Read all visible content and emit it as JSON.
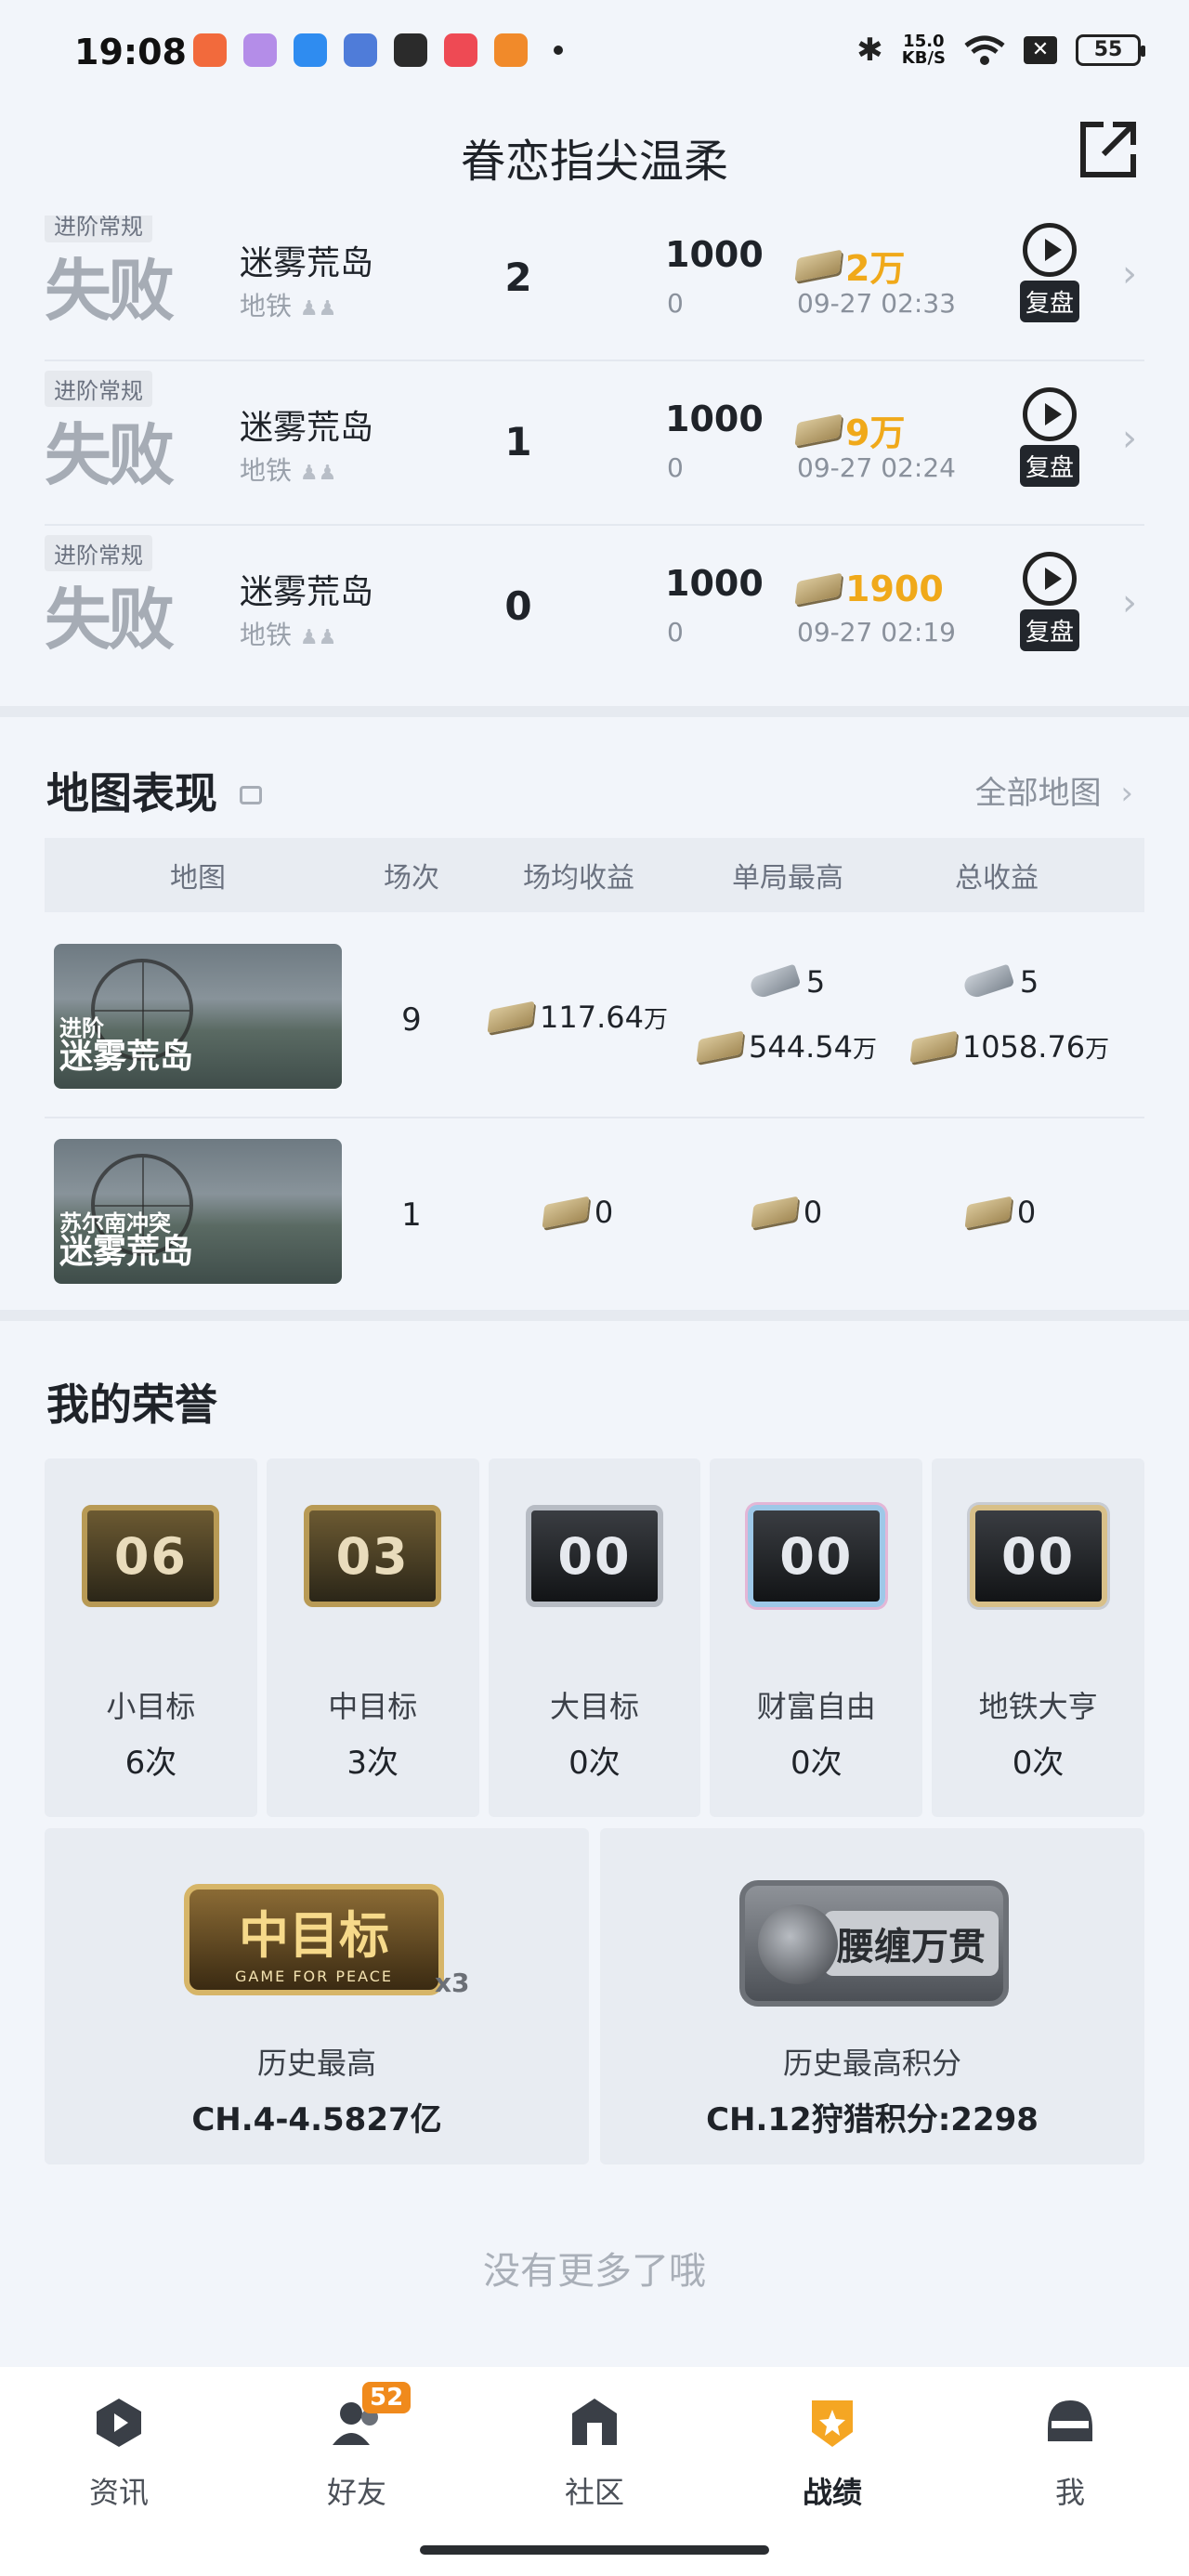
{
  "status_bar": {
    "time": "19:08",
    "net_speed": "15.0",
    "net_unit": "KB/S",
    "battery": "55"
  },
  "header": {
    "title": "眷恋指尖温柔"
  },
  "matches": [
    {
      "tag": "进阶常规",
      "result": "失败",
      "map": "迷雾荒岛",
      "mode": "地铁",
      "kills": "2",
      "score": "1000",
      "score_sub": "0",
      "reward": "2万",
      "time": "09-27 02:33",
      "replay": "复盘"
    },
    {
      "tag": "进阶常规",
      "result": "失败",
      "map": "迷雾荒岛",
      "mode": "地铁",
      "kills": "1",
      "score": "1000",
      "score_sub": "0",
      "reward": "9万",
      "time": "09-27 02:24",
      "replay": "复盘"
    },
    {
      "tag": "进阶常规",
      "result": "失败",
      "map": "迷雾荒岛",
      "mode": "地铁",
      "kills": "0",
      "score": "1000",
      "score_sub": "0",
      "reward": "1900",
      "time": "09-27 02:19",
      "replay": "复盘"
    }
  ],
  "map_section": {
    "title": "地图表现",
    "all_link": "全部地图",
    "columns": [
      "地图",
      "场次",
      "场均收益",
      "单局最高",
      "总收益"
    ],
    "rows": [
      {
        "sub": "进阶",
        "name": "迷雾荒岛",
        "count": "9",
        "avg": "117.64",
        "avg_unit": "万",
        "max_gun": "5",
        "max_cash": "544.54",
        "max_unit": "万",
        "total_gun": "5",
        "total_cash": "1058.76",
        "total_unit": "万"
      },
      {
        "sub": "苏尔南冲突",
        "name": "迷雾荒岛",
        "count": "1",
        "avg": "0",
        "max": "0",
        "total": "0"
      }
    ]
  },
  "honors": {
    "title": "我的荣誉",
    "items": [
      {
        "badge": "06",
        "name": "小目标",
        "count": "6次"
      },
      {
        "badge": "03",
        "name": "中目标",
        "count": "3次"
      },
      {
        "badge": "00",
        "name": "大目标",
        "count": "0次"
      },
      {
        "badge": "00",
        "name": "财富自由",
        "count": "0次"
      },
      {
        "badge": "00",
        "name": "地铁大亨",
        "count": "0次"
      }
    ],
    "history": [
      {
        "badge_main": "中目标",
        "badge_sub": "GAME FOR PEACE",
        "multiplier": "x3",
        "label": "历史最高",
        "value": "CH.4-4.5827亿"
      },
      {
        "badge_main": "腰缠万贯",
        "label": "历史最高积分",
        "value": "CH.12狩猎积分:2298"
      }
    ]
  },
  "footer_text": "没有更多了哦",
  "nav": [
    {
      "label": "资讯"
    },
    {
      "label": "好友",
      "badge": "52"
    },
    {
      "label": "社区"
    },
    {
      "label": "战绩"
    },
    {
      "label": "我"
    }
  ],
  "colors": {
    "accent": "#f0a91a",
    "nav_active": "#f5a623",
    "background": "#f2f5fa"
  }
}
